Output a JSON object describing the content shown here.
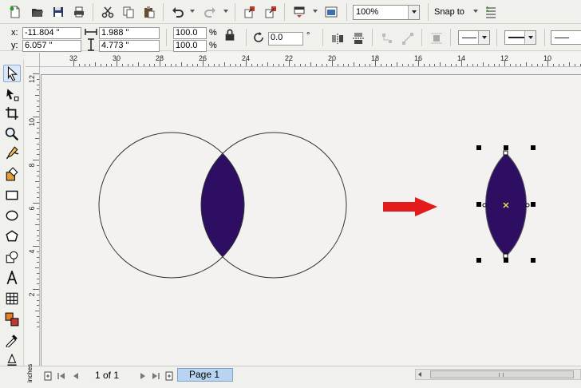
{
  "toolbar": {
    "zoom": "100%",
    "snap_label": "Snap to"
  },
  "propertybar": {
    "x_label": "x:",
    "y_label": "y:",
    "x_value": "-11.804 \"",
    "y_value": "6.057 \"",
    "width_value": "1.988 \"",
    "height_value": "4.773 \"",
    "scale_x": "100.0",
    "scale_y": "100.0",
    "percent": "%",
    "rotation": "0.0",
    "degree": "°"
  },
  "rulers": {
    "h_labels": [
      "32",
      "30",
      "28",
      "26",
      "24",
      "22",
      "20",
      "18",
      "16",
      "14",
      "12",
      "10"
    ],
    "v_labels": [
      "12",
      "10",
      "8",
      "6",
      "4",
      "2"
    ],
    "units": "inches"
  },
  "statusbar": {
    "page_count": "1 of 1",
    "page_tab": "Page 1"
  },
  "colors": {
    "fill": "#2e0e63",
    "arrow": "#e41b1b",
    "selection_handle": "#000000",
    "toolbar_bg": "#f0f0ed"
  }
}
